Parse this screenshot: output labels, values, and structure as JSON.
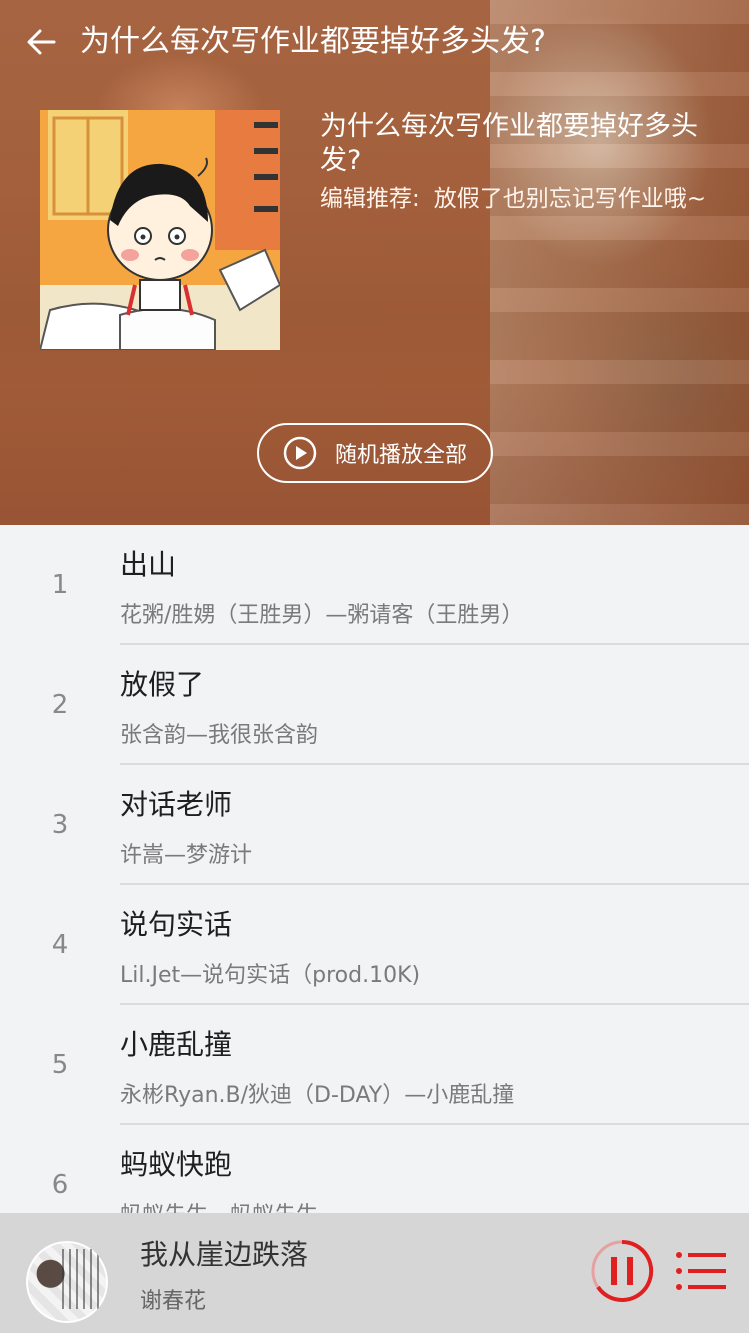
{
  "header": {
    "title": "为什么每次写作业都要掉好多头发?"
  },
  "playlist": {
    "title": "为什么每次写作业都要掉好多头发?",
    "editor_label": "编辑推荐:",
    "editor_text": "放假了也别忘记写作业哦~",
    "shuffle_label": "随机播放全部"
  },
  "songs": [
    {
      "index": "1",
      "title": "出山",
      "artist": "花粥/胜娚（王胜男）—粥请客（王胜男）"
    },
    {
      "index": "2",
      "title": "放假了",
      "artist": "张含韵—我很张含韵"
    },
    {
      "index": "3",
      "title": "对话老师",
      "artist": "许嵩—梦游计"
    },
    {
      "index": "4",
      "title": "说句实话",
      "artist": "Lil.Jet—说句实话（prod.10K)"
    },
    {
      "index": "5",
      "title": "小鹿乱撞",
      "artist": "永彬Ryan.B/狄迪（D-DAY）—小鹿乱撞"
    },
    {
      "index": "6",
      "title": "蚂蚁快跑",
      "artist": "蚂蚁先生—蚂蚁先生"
    }
  ],
  "player": {
    "song": "我从崖边跌落",
    "artist": "谢春花"
  },
  "colors": {
    "accent": "#e02020",
    "list_bg": "#f2f3f5",
    "player_bg": "#d6d6d6"
  },
  "icons": {
    "back": "back-arrow-icon",
    "shuffle": "play-circle-icon",
    "pause": "pause-circle-icon",
    "queue": "playlist-icon"
  }
}
